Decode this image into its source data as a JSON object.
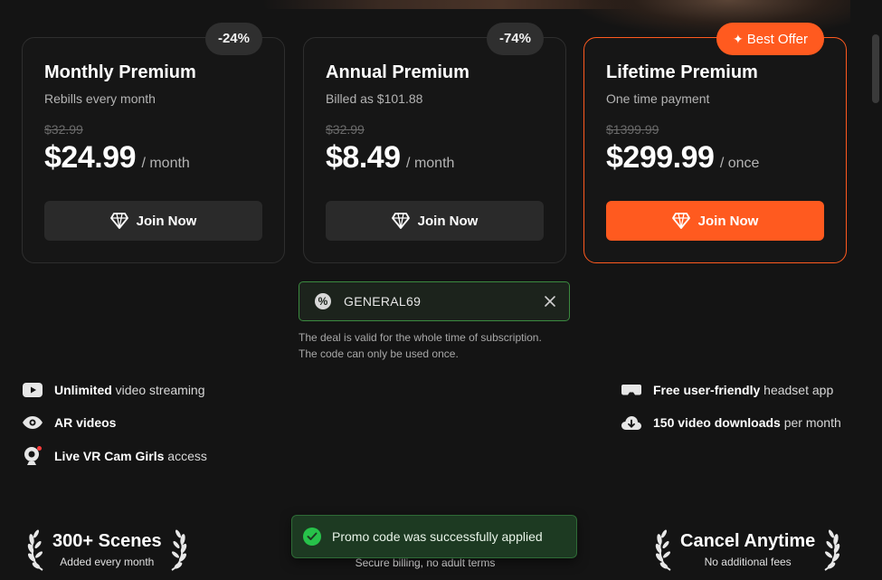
{
  "plans": [
    {
      "title": "Monthly Premium",
      "subtitle": "Rebills every month",
      "badge": "-24%",
      "old_price": "$32.99",
      "price": "$24.99",
      "period": "/ month",
      "button": "Join Now"
    },
    {
      "title": "Annual Premium",
      "subtitle": "Billed as $101.88",
      "badge": "-74%",
      "old_price": "$32.99",
      "price": "$8.49",
      "period": "/ month",
      "button": "Join Now"
    },
    {
      "title": "Lifetime Premium",
      "subtitle": "One time payment",
      "badge": "Best Offer",
      "old_price": "$1399.99",
      "price": "$299.99",
      "period": "/ once",
      "button": "Join Now"
    }
  ],
  "promo": {
    "code": "GENERAL69",
    "note_line1": "The deal is valid for the whole time of subscription.",
    "note_line2": "The code can only be used once."
  },
  "features_left": [
    {
      "bold": "Unlimited",
      "rest": " video streaming",
      "icon": "play-icon"
    },
    {
      "bold": "AR videos",
      "rest": "",
      "icon": "eye-icon"
    },
    {
      "bold": "Live VR Cam Girls",
      "rest": " access",
      "icon": "webcam-icon"
    }
  ],
  "features_right": [
    {
      "bold": "Free user-friendly",
      "rest": " headset app",
      "icon": "vr-headset-icon"
    },
    {
      "bold": "150 video downloads",
      "rest": " per month",
      "icon": "cloud-download-icon"
    }
  ],
  "stats": {
    "scenes_title": "300+ Scenes",
    "scenes_sub": "Added every month",
    "billing_sub": "Secure billing, no adult terms",
    "cancel_title": "Cancel Anytime",
    "cancel_sub": "No additional fees"
  },
  "toast": {
    "message": "Promo code was successfully applied"
  },
  "colors": {
    "accent": "#ff5a1f",
    "success": "#27c24a",
    "background": "#141414"
  }
}
